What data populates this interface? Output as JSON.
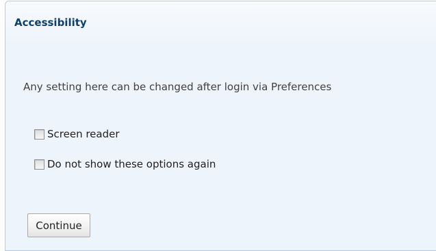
{
  "panel": {
    "title": "Accessibility",
    "info_text": "Any setting here can be changed after login via Preferences"
  },
  "options": [
    {
      "label": "Screen reader",
      "checked": false
    },
    {
      "label": "Do not show these options again",
      "checked": false
    }
  ],
  "actions": {
    "continue_label": "Continue"
  },
  "colors": {
    "title": "#0b3f6e",
    "panel_background": "#eef4fb",
    "panel_border": "#b9cbe0"
  }
}
